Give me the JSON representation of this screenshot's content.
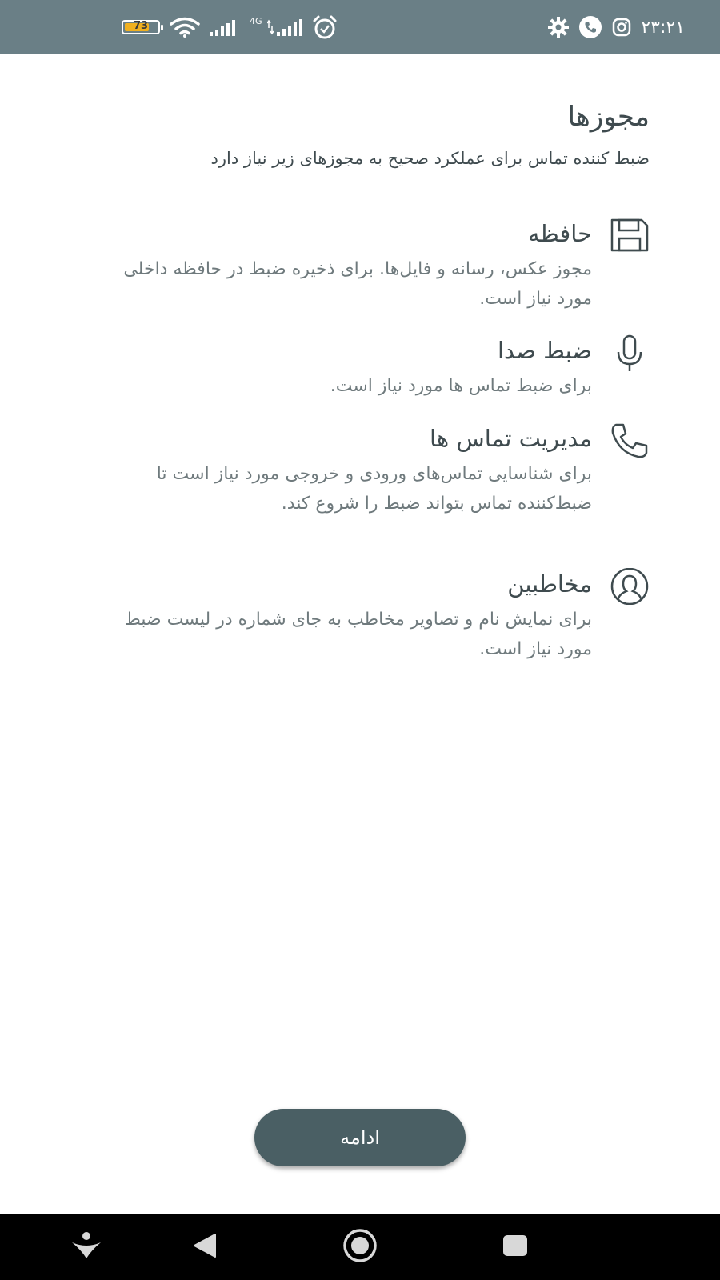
{
  "status_bar": {
    "time": "۲۳:۲۱",
    "battery_level": "73",
    "network_type": "4G",
    "icons": [
      "instagram-icon",
      "phone-call-icon",
      "settings-icon",
      "alarm-icon",
      "signal-icon",
      "wifi-icon",
      "battery-icon"
    ]
  },
  "header": {
    "title": "مجوزها",
    "subtitle": "ضبط کننده تماس برای عملکرد صحیح به مجوزهای زیر نیاز دارد"
  },
  "permissions": [
    {
      "icon": "floppy-disk-icon",
      "title": "حافظه",
      "description": "مجوز عکس، رسانه و فایل‌ها. برای ذخیره ضبط در حافظه داخلی مورد نیاز است."
    },
    {
      "icon": "microphone-icon",
      "title": "ضبط صدا",
      "description": "برای ضبط تماس ها مورد نیاز است."
    },
    {
      "icon": "phone-icon",
      "title": "مدیریت تماس ها",
      "description": "برای شناسایی تماس‌های ورودی و خروجی مورد نیاز است تا ضبط‌کننده تماس بتواند ضبط را شروع کند."
    },
    {
      "icon": "contact-icon",
      "title": "مخاطبین",
      "description": "برای نمایش نام و تصاویر مخاطب به جای شماره در لیست ضبط مورد نیاز است."
    }
  ],
  "continue_button": {
    "label": "ادامه"
  },
  "nav_bar": {
    "items": [
      "assistant-icon",
      "back-icon",
      "home-icon",
      "recents-icon"
    ]
  },
  "colors": {
    "status_bar": "#6a7f86",
    "accent": "#4a5f64",
    "text": "#3f4b4f",
    "muted_text": "#6f7a7d",
    "battery": "#f0b020"
  }
}
